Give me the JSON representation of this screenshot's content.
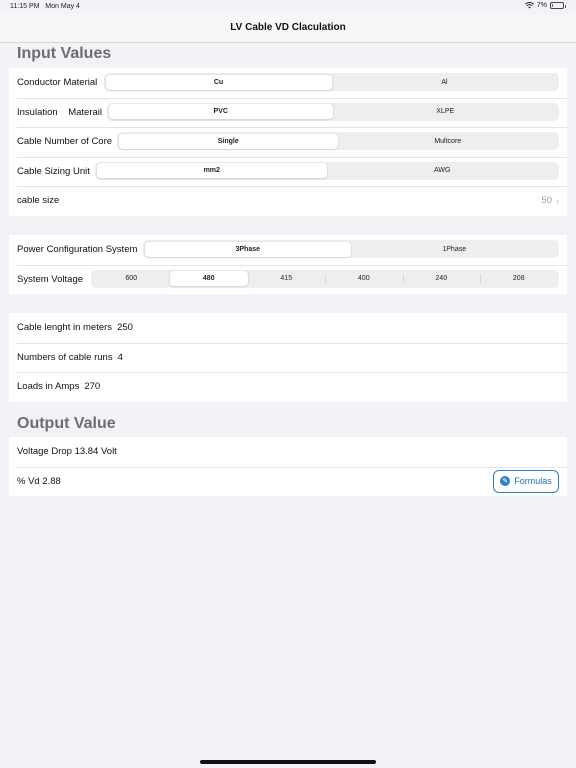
{
  "status_bar": {
    "time": "11:15 PM",
    "date": "Mon May 4",
    "battery_percent": "7%"
  },
  "nav": {
    "title": "LV Cable VD Claculation"
  },
  "input_section": {
    "header": "Input Values",
    "conductor_material": {
      "label": "Conductor Material",
      "options": [
        "Cu",
        "Al"
      ],
      "selected": 0
    },
    "insulation": {
      "label": "Insulation    Materail",
      "options": [
        "PVC",
        "XLPE"
      ],
      "selected": 0
    },
    "cores": {
      "label": "Cable Number of Core",
      "options": [
        "Single",
        "Multcore"
      ],
      "selected": 0
    },
    "sizing_unit": {
      "label": "Cable Sizing Unit",
      "options": [
        "mm2",
        "AWG"
      ],
      "selected": 0
    },
    "cable_size": {
      "label": "cable size",
      "value": "50"
    }
  },
  "power_section": {
    "config": {
      "label": "Power Configuration System",
      "options": [
        "3Phase",
        "1Phase"
      ],
      "selected": 0
    },
    "voltage": {
      "label": "System Voltage",
      "options": [
        "600",
        "480",
        "415",
        "400",
        "240",
        "208"
      ],
      "selected": 1
    }
  },
  "cable_section": {
    "length": {
      "label": "Cable lenght in meters",
      "value": "250"
    },
    "runs": {
      "label": "Numbers of cable runs",
      "value": "4"
    },
    "loads": {
      "label": "Loads in Amps",
      "value": "270"
    }
  },
  "output_section": {
    "header": "Output Value",
    "voltage_drop": "Voltage Drop 13.84 Volt",
    "percent_vd": "% Vd 2.88",
    "formulas_button": "Formulas"
  },
  "colors": {
    "background": "#f2f2f7",
    "accent": "#2f80c7",
    "section_header": "#6d6d72"
  }
}
